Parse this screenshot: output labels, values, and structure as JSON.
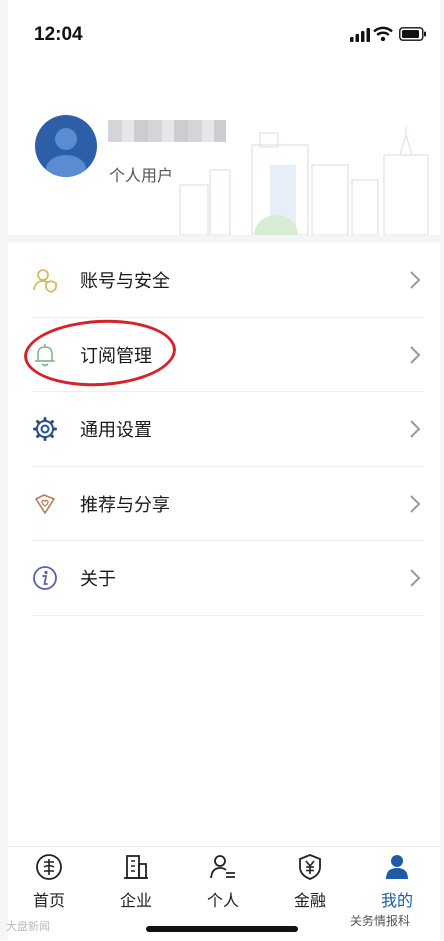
{
  "status_bar": {
    "time": "12:04"
  },
  "profile": {
    "user_type": "个人用户"
  },
  "menu": {
    "items": [
      {
        "label": "账号与安全",
        "icon": "user-shield-icon"
      },
      {
        "label": "订阅管理",
        "icon": "bell-icon"
      },
      {
        "label": "通用设置",
        "icon": "gear-icon"
      },
      {
        "label": "推荐与分享",
        "icon": "tag-heart-icon"
      },
      {
        "label": "关于",
        "icon": "info-icon"
      }
    ]
  },
  "tabs": [
    {
      "label": "首页",
      "icon": "home-emblem-icon",
      "active": false
    },
    {
      "label": "企业",
      "icon": "building-icon",
      "active": false
    },
    {
      "label": "个人",
      "icon": "person-list-icon",
      "active": false
    },
    {
      "label": "金融",
      "icon": "yuan-shield-icon",
      "active": false
    },
    {
      "label": "我的",
      "icon": "person-filled-icon",
      "active": true
    }
  ],
  "watermark": {
    "left": "大盘新闻",
    "right": "关务情报科"
  },
  "colors": {
    "accent": "#1e5aa8",
    "annotation": "#d6232a"
  }
}
